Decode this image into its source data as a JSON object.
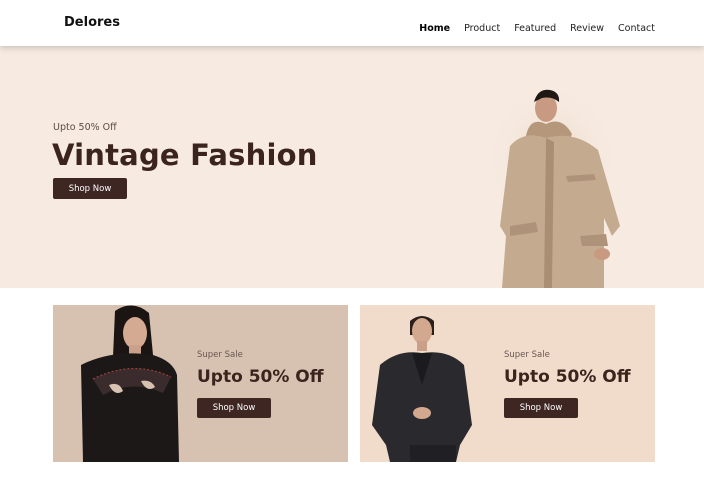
{
  "brand": {
    "logo_text": "Delores"
  },
  "nav": {
    "items": [
      {
        "label": "Home",
        "active": true
      },
      {
        "label": "Product",
        "active": false
      },
      {
        "label": "Featured",
        "active": false
      },
      {
        "label": "Review",
        "active": false
      },
      {
        "label": "Contact",
        "active": false
      }
    ]
  },
  "hero": {
    "eyebrow": "Upto 50% Off",
    "title": "Vintage Fashion",
    "cta_label": "Shop Now",
    "image": "model-in-beige-coat"
  },
  "promos": [
    {
      "eyebrow": "Super Sale",
      "title": "Upto 50% Off",
      "cta_label": "Shop Now",
      "image": "model-in-black-knit-top"
    },
    {
      "eyebrow": "Super Sale",
      "title": "Upto 50% Off",
      "cta_label": "Shop Now",
      "image": "model-in-black-blazer"
    }
  ],
  "colors": {
    "hero_bg": "#f7ebe1",
    "promo_1_bg": "#d7c1b1",
    "promo_2_bg": "#f1dccb",
    "button": "#3e2723"
  }
}
